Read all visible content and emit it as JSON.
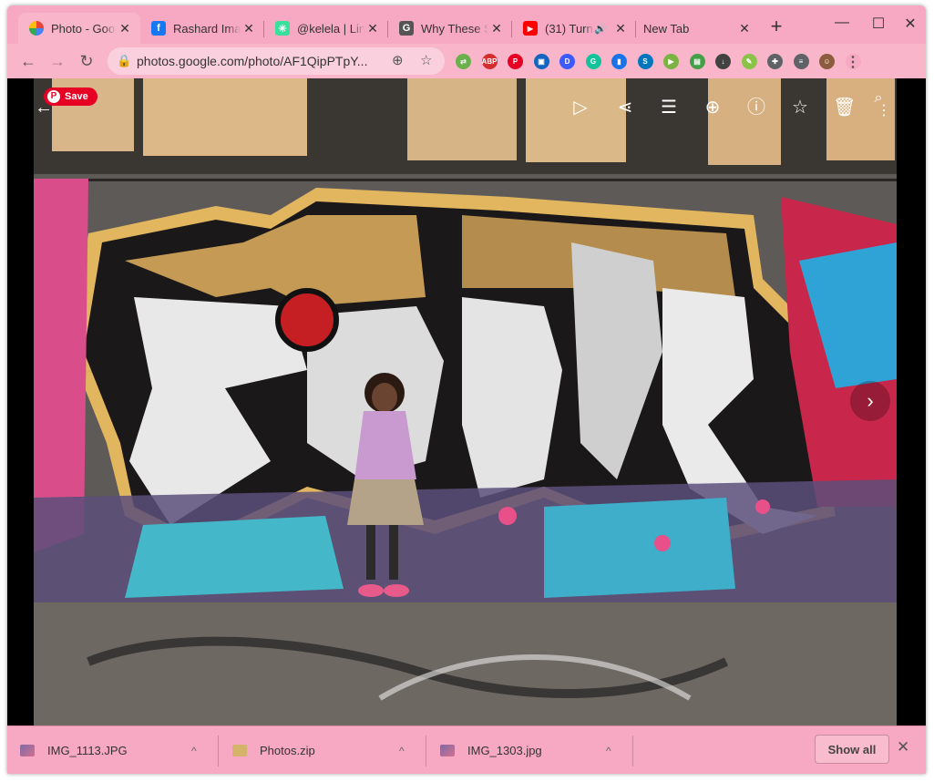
{
  "tabs": [
    {
      "title": "Photo - Goo",
      "close": "✕",
      "favicon_color": "#ea4335",
      "favicon_glyph": ""
    },
    {
      "title": "Rashard Ima",
      "close": "✕",
      "favicon_color": "#1877f2",
      "favicon_glyph": "f"
    },
    {
      "title": "@kelela | Lin",
      "close": "✕",
      "favicon_color": "#39e09b",
      "favicon_glyph": "✳"
    },
    {
      "title": "Why These S",
      "close": "✕",
      "favicon_color": "#555555",
      "favicon_glyph": "G"
    },
    {
      "title": "(31) Turn",
      "close": "✕",
      "favicon_color": "#ff0000",
      "favicon_glyph": "▶"
    },
    {
      "title": "New Tab",
      "close": "✕",
      "favicon_color": "",
      "favicon_glyph": ""
    }
  ],
  "audio_icon": "🔊",
  "new_tab": "+",
  "window_controls": {
    "minimize": "—",
    "maximize": "☐",
    "close": "✕"
  },
  "nav": {
    "back": "←",
    "forward": "→",
    "reload": "↻"
  },
  "omnibox": {
    "lock": "🔒",
    "url": "photos.google.com/photo/AF1QipPTpY...",
    "add": "⊕",
    "star": "☆"
  },
  "extensions": [
    {
      "name": "ext-1",
      "color": "#6ab04c",
      "glyph": "⇄"
    },
    {
      "name": "adblock",
      "color": "#d32f2f",
      "glyph": "ABP"
    },
    {
      "name": "pinterest",
      "color": "#e60023",
      "glyph": "P"
    },
    {
      "name": "ext-book",
      "color": "#1565c0",
      "glyph": "▣"
    },
    {
      "name": "ext-d",
      "color": "#3d5afe",
      "glyph": "D"
    },
    {
      "name": "grammarly",
      "color": "#15c39a",
      "glyph": "G"
    },
    {
      "name": "ext-bookmark",
      "color": "#1a73e8",
      "glyph": "▮"
    },
    {
      "name": "ext-s",
      "color": "#0277bd",
      "glyph": "S"
    },
    {
      "name": "ext-play",
      "color": "#7cb342",
      "glyph": "▶"
    },
    {
      "name": "ext-print",
      "color": "#43a047",
      "glyph": "▤"
    },
    {
      "name": "ext-download",
      "color": "#424242",
      "glyph": "↓"
    },
    {
      "name": "ext-paint",
      "color": "#8bc34a",
      "glyph": "✎"
    },
    {
      "name": "extensions-puzzle",
      "color": "#5f6368",
      "glyph": "✚"
    },
    {
      "name": "ext-list",
      "color": "#5f6368",
      "glyph": "≡"
    },
    {
      "name": "profile-avatar",
      "color": "#8d5b3e",
      "glyph": "☺"
    },
    {
      "name": "menu-kebab",
      "color": "#f7a8c2",
      "glyph": "⋮"
    }
  ],
  "viewer": {
    "pin_save": "Save",
    "pin_glyph": "P",
    "back": "←",
    "slideshow": "▷",
    "share": "⋖",
    "edit": "☰",
    "zoom": "⊕",
    "info": "ⓘ",
    "favorite": "☆",
    "delete": "🗑",
    "lens": "⌕",
    "more": "⋮",
    "next": "›"
  },
  "downloads": [
    {
      "filename": "IMG_1113.JPG",
      "type": "image",
      "chevron": "^"
    },
    {
      "filename": "Photos.zip",
      "type": "zip",
      "chevron": "^"
    },
    {
      "filename": "IMG_1303.jpg",
      "type": "image",
      "chevron": "^"
    }
  ],
  "shelf": {
    "show_all": "Show all",
    "close": "✕"
  }
}
